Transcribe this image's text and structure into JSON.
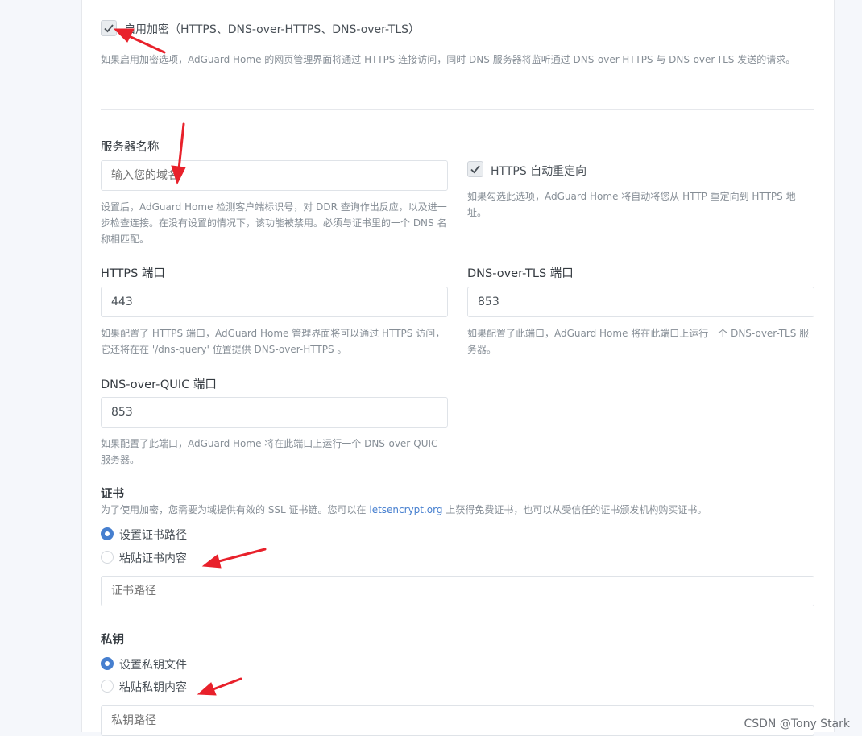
{
  "encryption": {
    "enable_label": "启用加密（HTTPS、DNS-over-HTTPS、DNS-over-TLS）",
    "enable_help": "如果启用加密选项，AdGuard Home 的网页管理界面将通过 HTTPS 连接访问，同时 DNS 服务器将监听通过 DNS-over-HTTPS 与 DNS-over-TLS 发送的请求。",
    "enabled": true
  },
  "server_name": {
    "label": "服务器名称",
    "placeholder": "输入您的域名",
    "help": "设置后，AdGuard Home 检测客户端标识号，对 DDR 查询作出反应，以及进一步检查连接。在没有设置的情况下，该功能被禁用。必须与证书里的一个 DNS 名称相匹配。"
  },
  "redirect": {
    "label": "HTTPS 自动重定向",
    "help": "如果勾选此选项，AdGuard Home 将自动将您从 HTTP 重定向到 HTTPS 地址。",
    "checked": true
  },
  "https_port": {
    "label": "HTTPS 端口",
    "value": "443",
    "help": "如果配置了 HTTPS 端口，AdGuard Home 管理界面将可以通过 HTTPS 访问，它还将在在 '/dns-query' 位置提供 DNS-over-HTTPS 。"
  },
  "dot_port": {
    "label": "DNS-over-TLS 端口",
    "value": "853",
    "help": "如果配置了此端口，AdGuard Home 将在此端口上运行一个 DNS-over-TLS 服务器。"
  },
  "doq_port": {
    "label": "DNS-over-QUIC 端口",
    "value": "853",
    "help": "如果配置了此端口，AdGuard Home 将在此端口上运行一个 DNS-over-QUIC 服务器。"
  },
  "certificate": {
    "title": "证书",
    "help_prefix": "为了使用加密，您需要为域提供有效的 SSL 证书链。您可以在 ",
    "help_link": "letsencrypt.org",
    "help_suffix": " 上获得免费证书，也可以从受信任的证书颁发机构购买证书。",
    "option_path": "设置证书路径",
    "option_paste": "粘贴证书内容",
    "selected": "设置证书路径",
    "path_placeholder": "证书路径"
  },
  "private_key": {
    "title": "私钥",
    "option_file": "设置私钥文件",
    "option_paste": "粘贴私钥内容",
    "selected": "设置私钥文件",
    "path_placeholder": "私钥路径"
  },
  "watermark": "CSDN @Tony Stark",
  "colors": {
    "accent": "#467fcf",
    "arrow": "#e8212b",
    "background": "#f5f7fb"
  }
}
